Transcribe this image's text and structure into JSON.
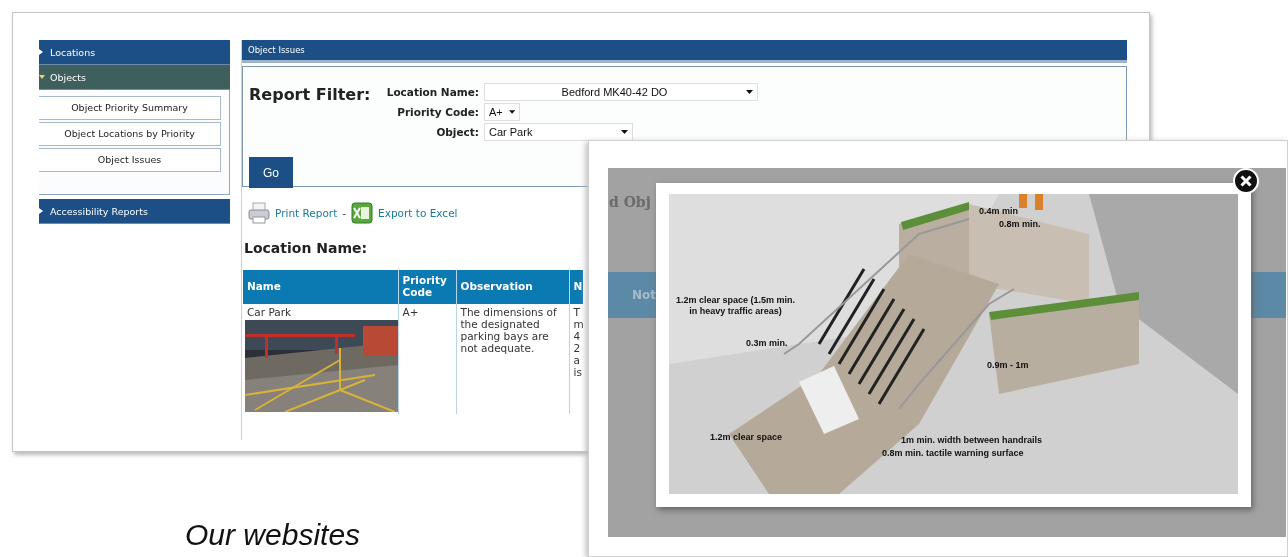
{
  "report_window": {
    "sidebar": [
      {
        "label": "Locations",
        "expanded": false
      },
      {
        "label": "Objects",
        "expanded": true,
        "children": [
          {
            "label": "Object Priority Summary"
          },
          {
            "label": "Object Locations by Priority"
          },
          {
            "label": "Object Issues"
          }
        ]
      },
      {
        "label": "Accessibility Reports",
        "expanded": false
      }
    ],
    "panel_title": "Object Issues",
    "filter": {
      "heading": "Report Filter:",
      "fields": [
        {
          "label": "Location Name:",
          "value": "Bedford MK40-42 DO"
        },
        {
          "label": "Priority Code:",
          "value": "A+"
        },
        {
          "label": "Object:",
          "value": "Car Park"
        }
      ],
      "submit": "Go"
    },
    "actions": [
      {
        "kind": "print",
        "label": "Print Report"
      },
      {
        "kind": "excel",
        "label": "Export to Excel"
      }
    ],
    "action_separator": "-",
    "section_heading": "Location Name:",
    "table": {
      "columns": [
        "Name",
        "Priority Code",
        "Observation",
        "N"
      ],
      "rows": [
        {
          "name": "Car Park",
          "priority": "A+",
          "observation": "The dimensions of the designated parking bays are not adequate.",
          "column_4_lines": [
            "T",
            "m",
            "4",
            "2",
            "a",
            "is"
          ]
        }
      ]
    }
  },
  "image_window": {
    "background_heading": "d Obj",
    "background_column": "Not",
    "labels": [
      {
        "text": "0.4m min"
      },
      {
        "text": "0.8m min."
      },
      {
        "text": "1.2m clear space (1.5m min.\nin heavy traffic areas)"
      },
      {
        "text": "0.3m min."
      },
      {
        "text": "0.9m - 1m"
      },
      {
        "text": "1.2m clear space"
      },
      {
        "text": "1m min. width between handrails"
      },
      {
        "text": "0.8m min. tactile warning surface"
      }
    ]
  },
  "caption": "Our websites"
}
